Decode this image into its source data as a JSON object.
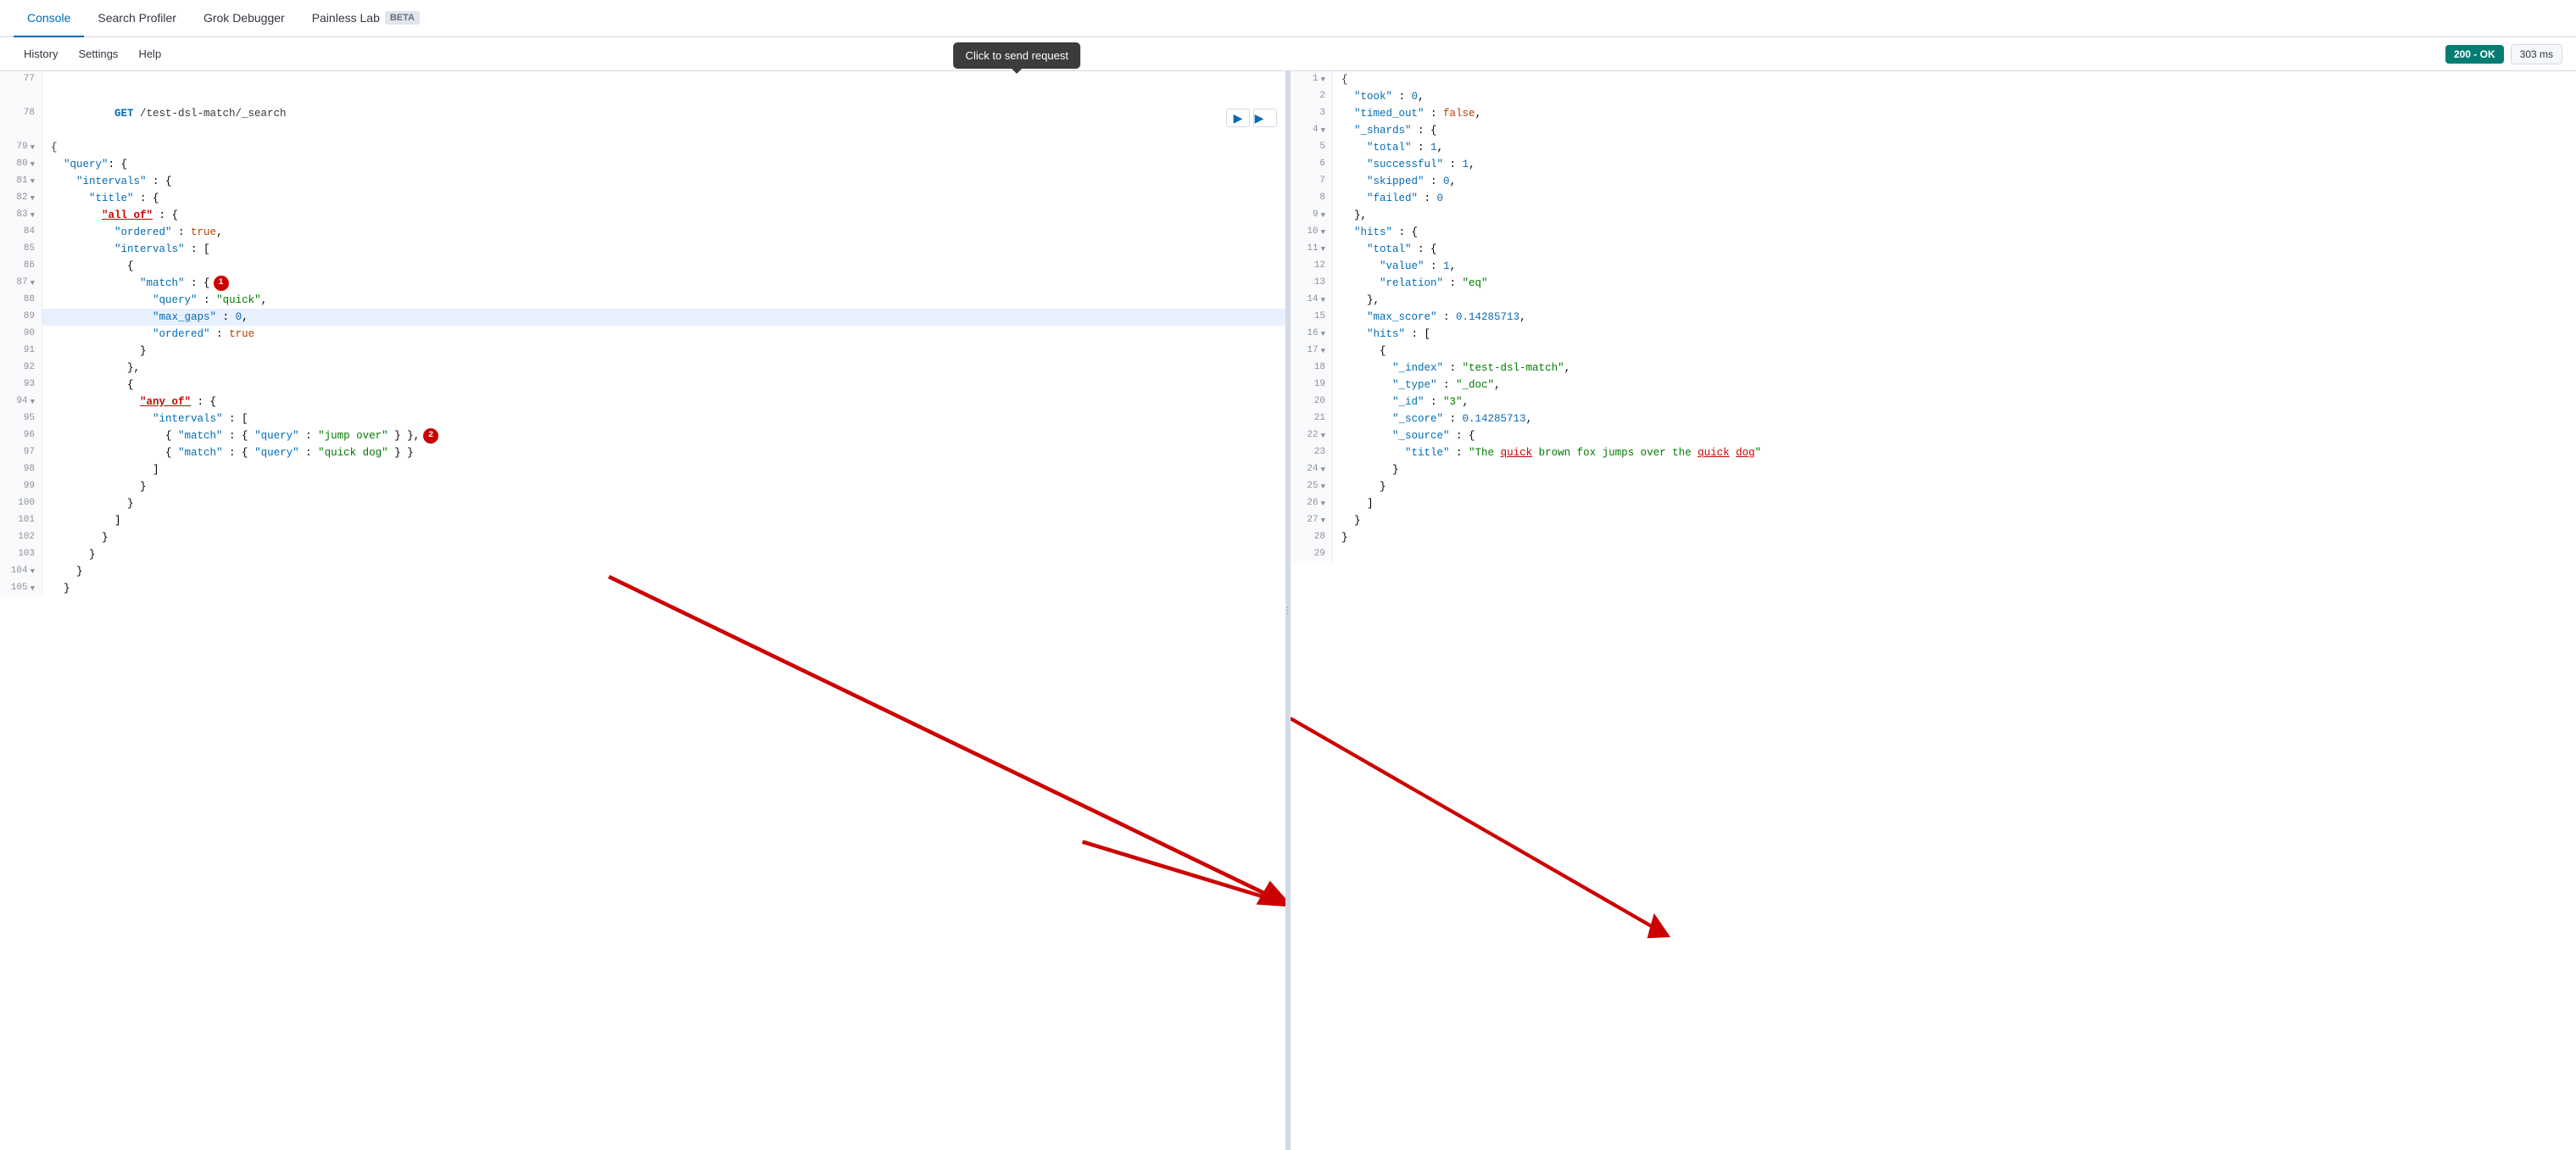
{
  "nav": {
    "tabs": [
      {
        "id": "console",
        "label": "Console",
        "active": true
      },
      {
        "id": "search-profiler",
        "label": "Search Profiler"
      },
      {
        "id": "grok-debugger",
        "label": "Grok Debugger"
      },
      {
        "id": "painless-lab",
        "label": "Painless Lab"
      }
    ],
    "beta_label": "BETA"
  },
  "toolbar": {
    "history": "History",
    "settings": "Settings",
    "help": "Help",
    "status_ok": "200 - OK",
    "status_time": "303 ms"
  },
  "tooltip": {
    "text": "Click to send request"
  },
  "editor": {
    "lines": [
      {
        "num": "77",
        "fold": false,
        "content": ""
      },
      {
        "num": "78",
        "fold": false,
        "content": "GET /test-dsl-match/_search",
        "type": "method"
      },
      {
        "num": "79",
        "fold": true,
        "content": "{"
      },
      {
        "num": "80",
        "fold": true,
        "content": "  \"query\": {"
      },
      {
        "num": "81",
        "fold": true,
        "content": "    \"intervals\" : {"
      },
      {
        "num": "82",
        "fold": true,
        "content": "      \"title\" : {"
      },
      {
        "num": "83",
        "fold": true,
        "content": "        \"all_of\" : {",
        "underline_key": true
      },
      {
        "num": "84",
        "fold": false,
        "content": "          \"ordered\" : true,"
      },
      {
        "num": "85",
        "fold": false,
        "content": "          \"intervals\" : ["
      },
      {
        "num": "86",
        "fold": false,
        "content": "            {"
      },
      {
        "num": "87",
        "fold": true,
        "content": "              \"match\" : {",
        "badge": "1"
      },
      {
        "num": "88",
        "fold": false,
        "content": "                \"query\" : \"quick\","
      },
      {
        "num": "89",
        "fold": false,
        "content": "                \"max_gaps\" : 0,",
        "highlight": true
      },
      {
        "num": "90",
        "fold": false,
        "content": "                \"ordered\" : true"
      },
      {
        "num": "91",
        "fold": false,
        "content": "              }"
      },
      {
        "num": "92",
        "fold": false,
        "content": "            },"
      },
      {
        "num": "93",
        "fold": false,
        "content": "            {"
      },
      {
        "num": "94",
        "fold": true,
        "content": "              \"any_of\" : {"
      },
      {
        "num": "95",
        "fold": false,
        "content": "                \"intervals\" : ["
      },
      {
        "num": "96",
        "fold": false,
        "content": "                  { \"match\" : { \"query\" : \"jump over\" } },",
        "badge": "2"
      },
      {
        "num": "97",
        "fold": false,
        "content": "                  { \"match\" : { \"query\" : \"quick dog\" } }"
      },
      {
        "num": "98",
        "fold": false,
        "content": "                ]"
      },
      {
        "num": "99",
        "fold": false,
        "content": "              }"
      },
      {
        "num": "100",
        "fold": false,
        "content": "            }"
      },
      {
        "num": "101",
        "fold": false,
        "content": "          ]"
      },
      {
        "num": "102",
        "fold": false,
        "content": "        }"
      },
      {
        "num": "103",
        "fold": false,
        "content": "      }"
      },
      {
        "num": "104",
        "fold": true,
        "content": "    }"
      },
      {
        "num": "105",
        "fold": true,
        "content": "  }"
      }
    ]
  },
  "response": {
    "lines": [
      {
        "num": "1",
        "fold": true,
        "content": "{"
      },
      {
        "num": "2",
        "fold": false,
        "content": "  \"took\" : 0,"
      },
      {
        "num": "3",
        "fold": false,
        "content": "  \"timed_out\" : false,"
      },
      {
        "num": "4",
        "fold": true,
        "content": "  \"_shards\" : {"
      },
      {
        "num": "5",
        "fold": false,
        "content": "    \"total\" : 1,"
      },
      {
        "num": "6",
        "fold": false,
        "content": "    \"successful\" : 1,"
      },
      {
        "num": "7",
        "fold": false,
        "content": "    \"skipped\" : 0,"
      },
      {
        "num": "8",
        "fold": false,
        "content": "    \"failed\" : 0"
      },
      {
        "num": "9",
        "fold": true,
        "content": "  },"
      },
      {
        "num": "10",
        "fold": true,
        "content": "  \"hits\" : {"
      },
      {
        "num": "11",
        "fold": true,
        "content": "    \"total\" : {"
      },
      {
        "num": "12",
        "fold": false,
        "content": "      \"value\" : 1,"
      },
      {
        "num": "13",
        "fold": false,
        "content": "      \"relation\" : \"eq\""
      },
      {
        "num": "14",
        "fold": true,
        "content": "    },"
      },
      {
        "num": "15",
        "fold": false,
        "content": "    \"max_score\" : 0.14285713,"
      },
      {
        "num": "16",
        "fold": true,
        "content": "    \"hits\" : ["
      },
      {
        "num": "17",
        "fold": true,
        "content": "      {"
      },
      {
        "num": "18",
        "fold": false,
        "content": "        \"_index\" : \"test-dsl-match\","
      },
      {
        "num": "19",
        "fold": false,
        "content": "        \"_type\" : \"_doc\","
      },
      {
        "num": "20",
        "fold": false,
        "content": "        \"_id\" : \"3\","
      },
      {
        "num": "21",
        "fold": false,
        "content": "        \"_score\" : 0.14285713,"
      },
      {
        "num": "22",
        "fold": true,
        "content": "        \"_source\" : {"
      },
      {
        "num": "23",
        "fold": false,
        "content": "          \"title\" : \"The quick brown fox jumps over the quick dog\"",
        "highlight_words": [
          "quick",
          "quick",
          "dog"
        ]
      },
      {
        "num": "24",
        "fold": true,
        "content": "        }"
      },
      {
        "num": "25",
        "fold": true,
        "content": "      }"
      },
      {
        "num": "26",
        "fold": true,
        "content": "    ]"
      },
      {
        "num": "27",
        "fold": true,
        "content": "  }"
      },
      {
        "num": "28",
        "fold": false,
        "content": "}"
      },
      {
        "num": "29",
        "fold": false,
        "content": ""
      }
    ]
  }
}
